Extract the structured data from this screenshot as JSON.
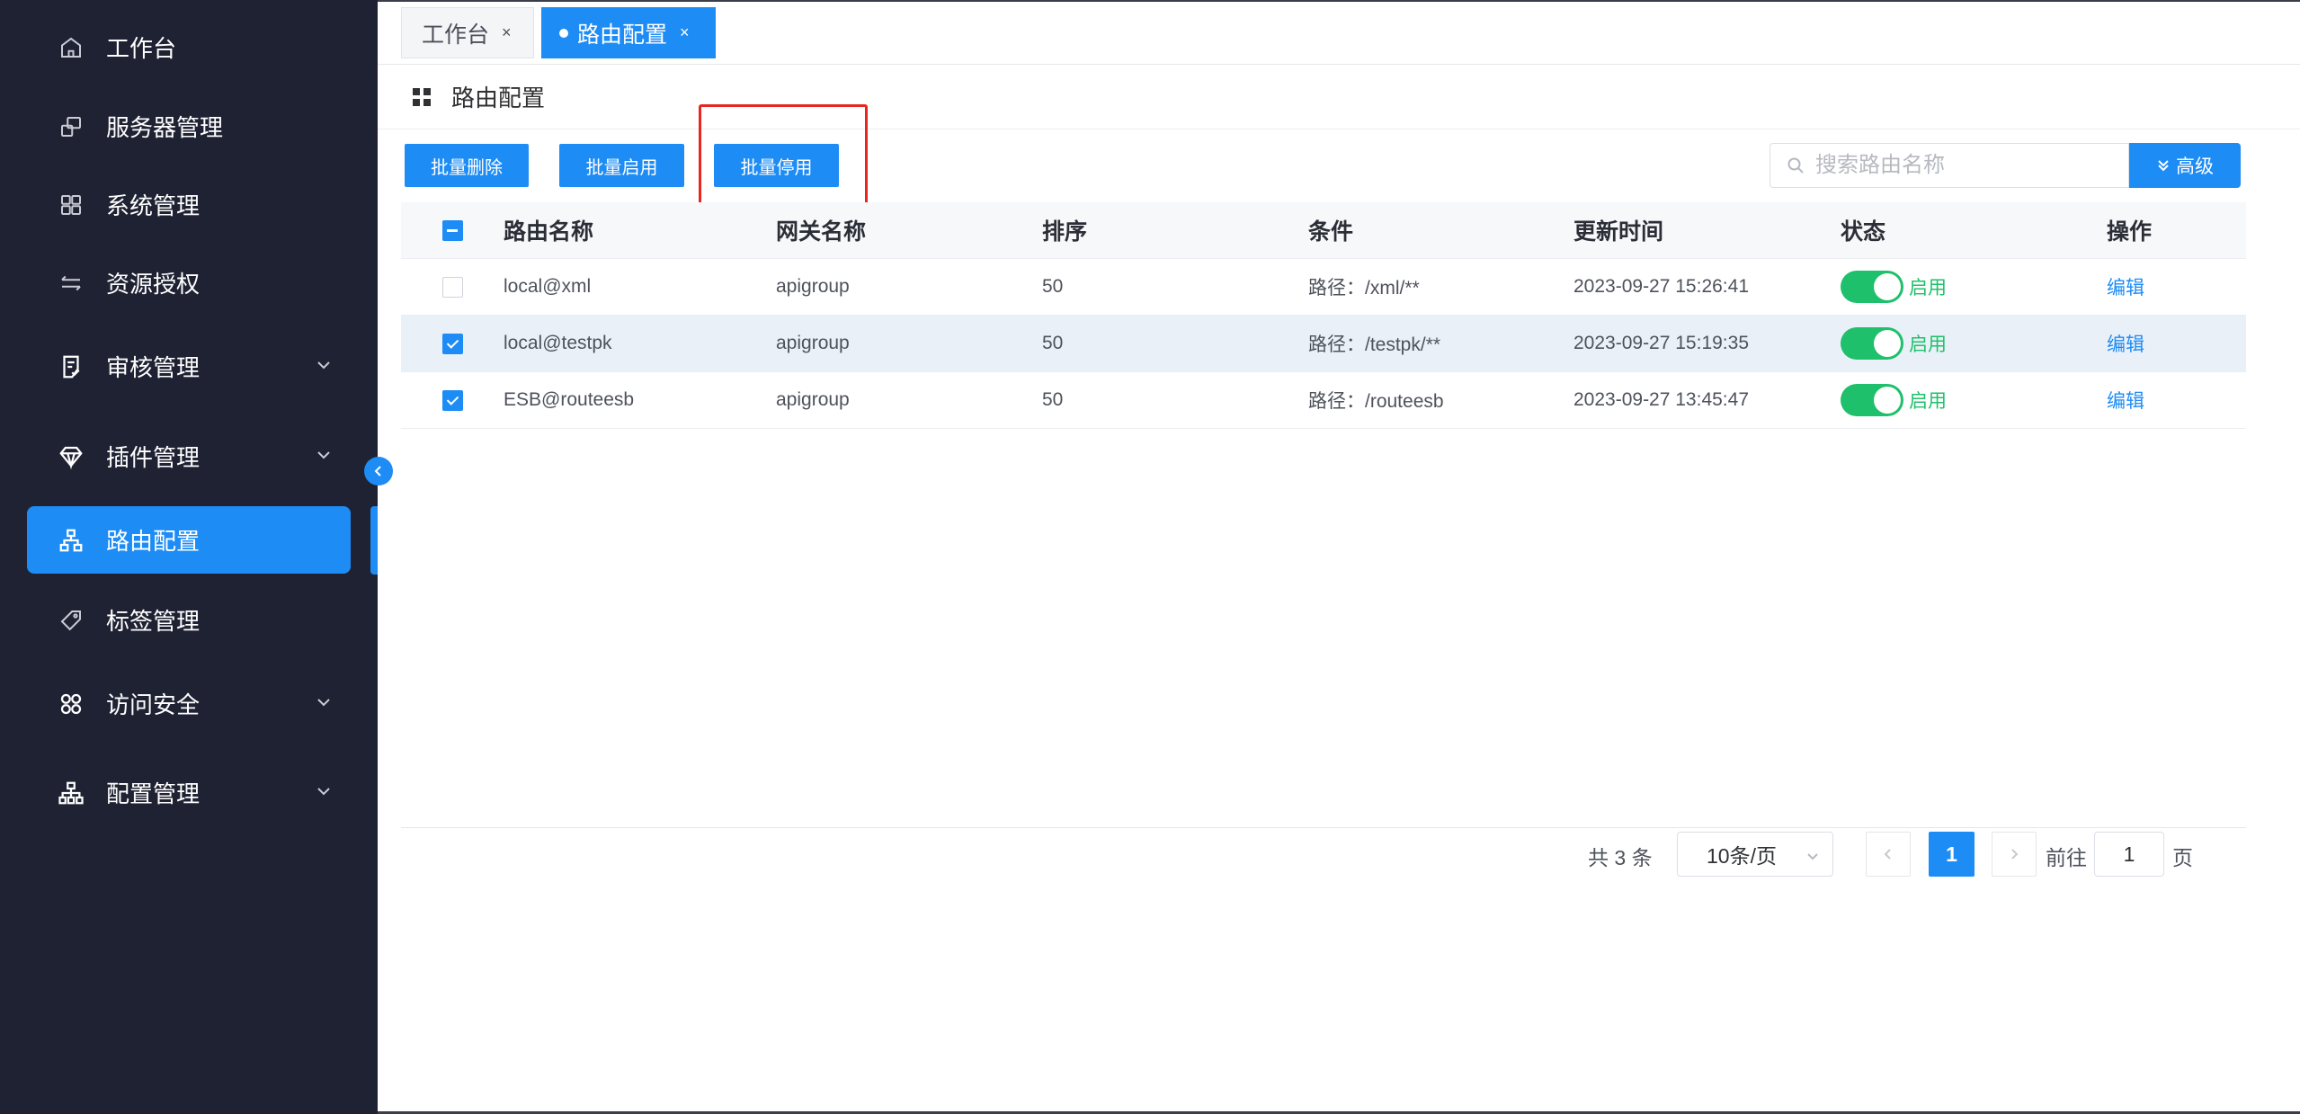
{
  "sidebar": {
    "items": [
      {
        "label": "工作台",
        "icon": "home-icon"
      },
      {
        "label": "服务器管理",
        "icon": "server-icon"
      },
      {
        "label": "系统管理",
        "icon": "grid-icon"
      },
      {
        "label": "资源授权",
        "icon": "transfer-icon"
      },
      {
        "label": "审核管理",
        "icon": "audit-icon"
      },
      {
        "label": "插件管理",
        "icon": "diamond-icon"
      },
      {
        "label": "路由配置",
        "icon": "route-icon"
      },
      {
        "label": "标签管理",
        "icon": "tag-icon"
      },
      {
        "label": "访问安全",
        "icon": "apps-icon"
      },
      {
        "label": "配置管理",
        "icon": "org-icon"
      }
    ],
    "active_item": "路由配置"
  },
  "tabs": [
    {
      "label": "工作台",
      "close": "×"
    },
    {
      "label": "路由配置",
      "close": "×"
    }
  ],
  "page": {
    "title": "路由配置"
  },
  "toolbar": {
    "batch_delete": "批量删除",
    "batch_enable": "批量启用",
    "batch_disable": "批量停用"
  },
  "search": {
    "placeholder": "搜索路由名称",
    "value": "",
    "advanced_label": "高级"
  },
  "table": {
    "columns": [
      "路由名称",
      "网关名称",
      "排序",
      "条件",
      "更新时间",
      "状态",
      "操作"
    ],
    "rows": [
      {
        "checked": false,
        "name": "local@xml",
        "gateway": "apigroup",
        "sort": "50",
        "condition": "路径：/xml/**",
        "updated": "2023-09-27 15:26:41",
        "status": "启用",
        "enabled": true,
        "action": "编辑"
      },
      {
        "checked": true,
        "name": "local@testpk",
        "gateway": "apigroup",
        "sort": "50",
        "condition": "路径：/testpk/**",
        "updated": "2023-09-27 15:19:35",
        "status": "启用",
        "enabled": true,
        "action": "编辑"
      },
      {
        "checked": true,
        "name": "ESB@routeesb",
        "gateway": "apigroup",
        "sort": "50",
        "condition": "路径：/routeesb",
        "updated": "2023-09-27 13:45:47",
        "status": "启用",
        "enabled": true,
        "action": "编辑"
      }
    ]
  },
  "pagination": {
    "total": "共 3 条",
    "page_size": "10条/页",
    "current_page": "1",
    "goto_label": "前往",
    "goto_value": "1",
    "page_unit": "页"
  },
  "colors": {
    "primary": "#1e8cf5",
    "sidebar_bg": "#1f2233",
    "success": "#1fc06b",
    "highlight": "#e8251f"
  }
}
